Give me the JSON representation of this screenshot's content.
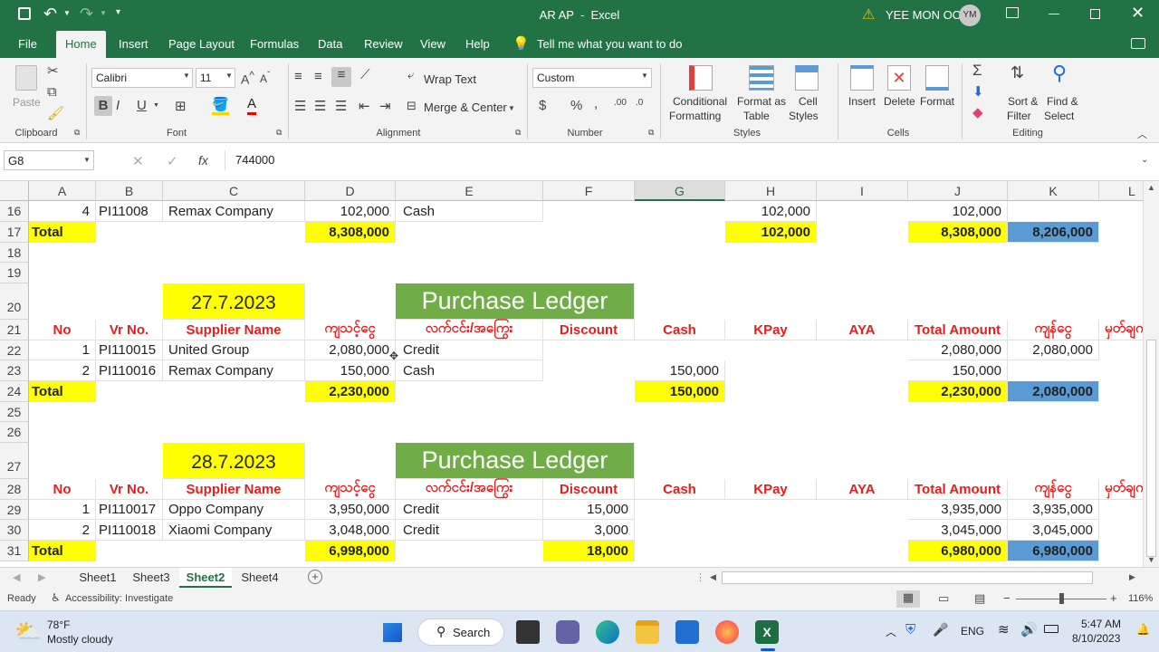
{
  "window": {
    "title": "AR AP  -  Excel",
    "user_name": "YEE MON OO",
    "user_initials": "YM"
  },
  "menu_tabs": [
    "File",
    "Home",
    "Insert",
    "Page Layout",
    "Formulas",
    "Data",
    "Review",
    "View",
    "Help"
  ],
  "tell_me": "Tell me what you want to do",
  "ribbon": {
    "clipboard": {
      "label": "Clipboard",
      "paste": "Paste"
    },
    "font": {
      "label": "Font",
      "name": "Calibri",
      "size": "11"
    },
    "alignment": {
      "label": "Alignment",
      "wrap_text": "Wrap Text",
      "merge_center": "Merge & Center"
    },
    "number": {
      "label": "Number",
      "format": "Custom"
    },
    "styles": {
      "label": "Styles",
      "conditional_1": "Conditional",
      "conditional_2": "Formatting",
      "format_table_1": "Format as",
      "format_table_2": "Table",
      "cell_styles_1": "Cell",
      "cell_styles_2": "Styles"
    },
    "cells": {
      "label": "Cells",
      "insert": "Insert",
      "delete": "Delete",
      "format": "Format"
    },
    "editing": {
      "label": "Editing",
      "sort_1": "Sort &",
      "sort_2": "Filter",
      "find_1": "Find &",
      "find_2": "Select"
    }
  },
  "formula_bar": {
    "name_box": "G8",
    "fx": "fx",
    "value": "744000"
  },
  "columns": [
    "A",
    "B",
    "C",
    "D",
    "E",
    "F",
    "G",
    "H",
    "I",
    "J",
    "K",
    "L"
  ],
  "rows": [
    "16",
    "17",
    "18",
    "19",
    "20",
    "21",
    "22",
    "23",
    "24",
    "25",
    "26",
    "27",
    "28",
    "29",
    "30",
    "31"
  ],
  "grid": {
    "r16": {
      "a": "4",
      "b": "PI11008",
      "c": "Remax Company",
      "d": "102,000",
      "e": "Cash",
      "h": "102,000",
      "j": "102,000"
    },
    "r17": {
      "a": "Total",
      "d": "8,308,000",
      "h": "102,000",
      "j": "8,308,000",
      "k": "8,206,000"
    },
    "block1": {
      "date": "27.7.2023",
      "ledger": "Purchase Ledger"
    },
    "headers": {
      "no": "No",
      "vr": "Vr No.",
      "supplier": "Supplier Name",
      "amount": "ကျသင့်ငွေ",
      "cash_credit": "လက်ငင်း/အကြွေး",
      "discount": "Discount",
      "cash": "Cash",
      "kpay": "KPay",
      "aya": "AYA",
      "total": "Total Amount",
      "balance": "ကျန်ငွေ",
      "remark": "မှတ်ချက်"
    },
    "r22": {
      "a": "1",
      "b": "PI110015",
      "c": "United Group",
      "d": "2,080,000",
      "e": "Credit",
      "j": "2,080,000",
      "k": "2,080,000"
    },
    "r23": {
      "a": "2",
      "b": "PI110016",
      "c": "Remax Company",
      "d": "150,000",
      "e": "Cash",
      "g": "150,000",
      "j": "150,000"
    },
    "r24": {
      "a": "Total",
      "d": "2,230,000",
      "g": "150,000",
      "j": "2,230,000",
      "k": "2,080,000"
    },
    "block2": {
      "date": "28.7.2023",
      "ledger": "Purchase Ledger"
    },
    "r29": {
      "a": "1",
      "b": "PI110017",
      "c": "Oppo Company",
      "d": "3,950,000",
      "e": "Credit",
      "f": "15,000",
      "j": "3,935,000",
      "k": "3,935,000"
    },
    "r30": {
      "a": "2",
      "b": "PI110018",
      "c": "Xiaomi Company",
      "d": "3,048,000",
      "e": "Credit",
      "f": "3,000",
      "j": "3,045,000",
      "k": "3,045,000"
    },
    "r31": {
      "a": "Total",
      "d": "6,998,000",
      "f": "18,000",
      "j": "6,980,000",
      "k": "6,980,000"
    }
  },
  "sheet_tabs": [
    "Sheet1",
    "Sheet3",
    "Sheet2",
    "Sheet4"
  ],
  "active_sheet": "Sheet2",
  "status": {
    "ready": "Ready",
    "accessibility": "Accessibility: Investigate",
    "zoom": "116%"
  },
  "taskbar": {
    "weather_temp": "78°F",
    "weather_desc": "Mostly cloudy",
    "search": "Search",
    "lang": "ENG",
    "time": "5:47 AM",
    "date": "8/10/2023"
  },
  "colors": {
    "excel_green": "#217346",
    "ledger_green": "#70ad47",
    "highlight_yellow": "#ffff00",
    "total_blue": "#5b9bd5",
    "header_red": "#e02020"
  }
}
